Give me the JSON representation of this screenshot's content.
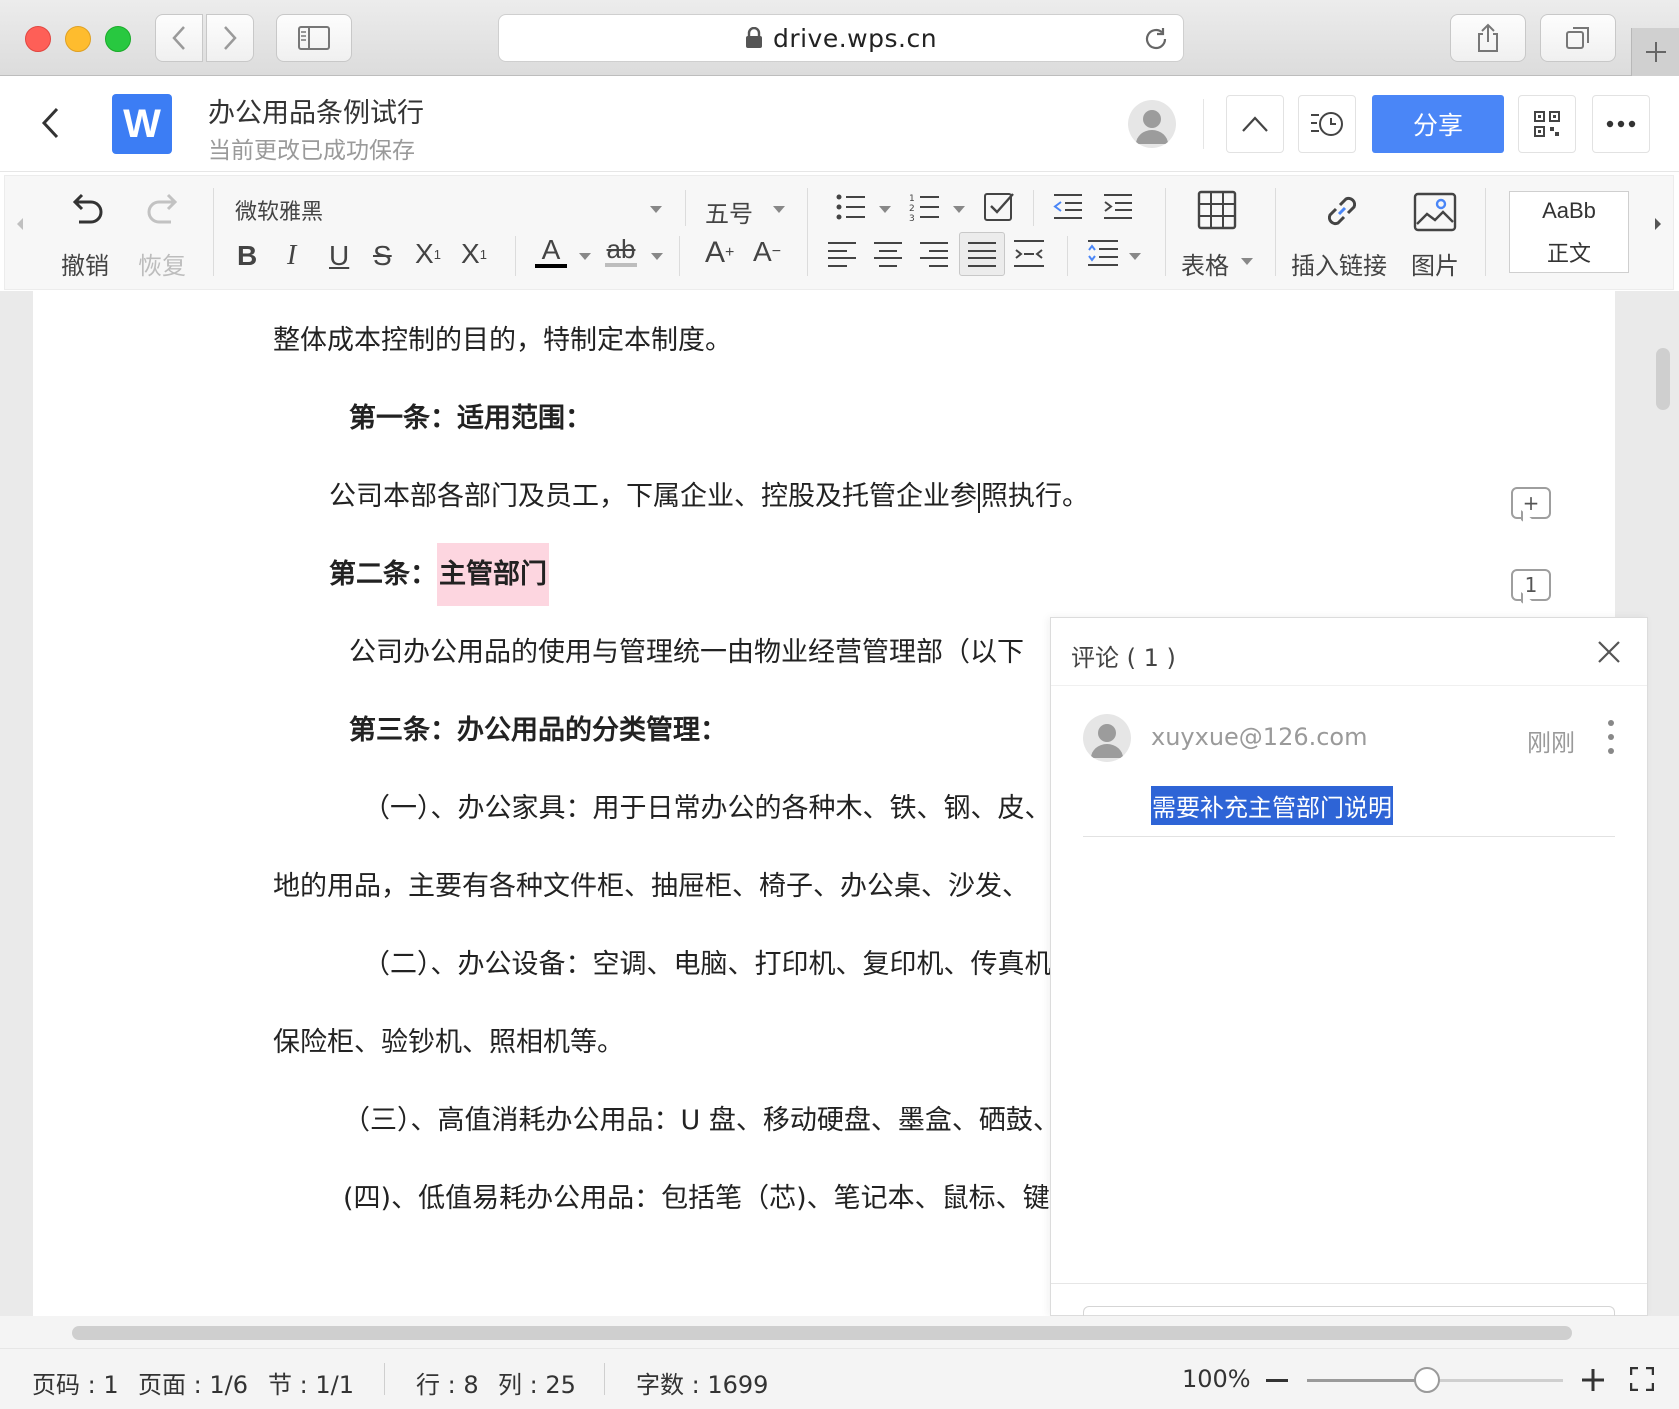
{
  "browser": {
    "url": "drive.wps.cn",
    "icons": [
      "back-chevron",
      "forward-chevron",
      "sidebar-icon",
      "lock-icon",
      "reload-icon",
      "share-icon",
      "tabs-icon",
      "plus-icon"
    ]
  },
  "header": {
    "app_logo": "W",
    "title": "办公用品条例试行",
    "status": "当前更改已成功保存",
    "share_label": "分享"
  },
  "toolbar": {
    "undo_label": "撤销",
    "redo_label": "恢复",
    "font_name": "微软雅黑",
    "font_size": "五号",
    "table_label": "表格",
    "link_label": "插入链接",
    "image_label": "图片",
    "style_preview": "AaBb",
    "style_name": "正文",
    "text_color": "#000000"
  },
  "document": {
    "paragraphs": [
      {
        "text": "整体成本控制的目的，特制定本制度。"
      },
      {
        "text": "第一条：适用范围："
      },
      {
        "text_before": "公司本部各部门及员工，下属企业、控股及托管企业参",
        "text_after": "照执行。"
      },
      {
        "text_prefix": "第二条：",
        "text_highlight": "主管部门"
      },
      {
        "text": "公司办公用品的使用与管理统一由物业经营管理部（以下"
      },
      {
        "text": "第三条：办公用品的分类管理："
      },
      {
        "text": "（一）、办公家具：用于日常办公的各种木、铁、钢、皮、"
      },
      {
        "text": "地的用品，主要有各种文件柜、抽屉柜、椅子、办公桌、沙发、"
      },
      {
        "text": "（二）、办公设备：空调、电脑、打印机、复印机、传真机"
      },
      {
        "text": "保险柜、验钞机、照相机等。"
      },
      {
        "text": "（三）、高值消耗办公用品：U 盘、移动硬盘、墨盒、硒鼓、"
      },
      {
        "text": "(四)、低值易耗办公用品：包括笔（芯)、笔记本、鼠标、键盘"
      }
    ],
    "add_comment_marker": "+",
    "comment_count_marker": "1"
  },
  "comments": {
    "title": "评论 ( 1 )",
    "items": [
      {
        "user": "xuyxue@126.com",
        "time": "刚刚",
        "text": "需要补充主管部门说明"
      }
    ]
  },
  "status_bar": {
    "page_num": "页码 : 1",
    "pages": "页面 : 1/6",
    "section": "节 : 1/1",
    "row": "行 : 8",
    "column": "列 : 25",
    "word_count": "字数 : 1699",
    "zoom": "100%",
    "zoom_level": 0.47
  }
}
